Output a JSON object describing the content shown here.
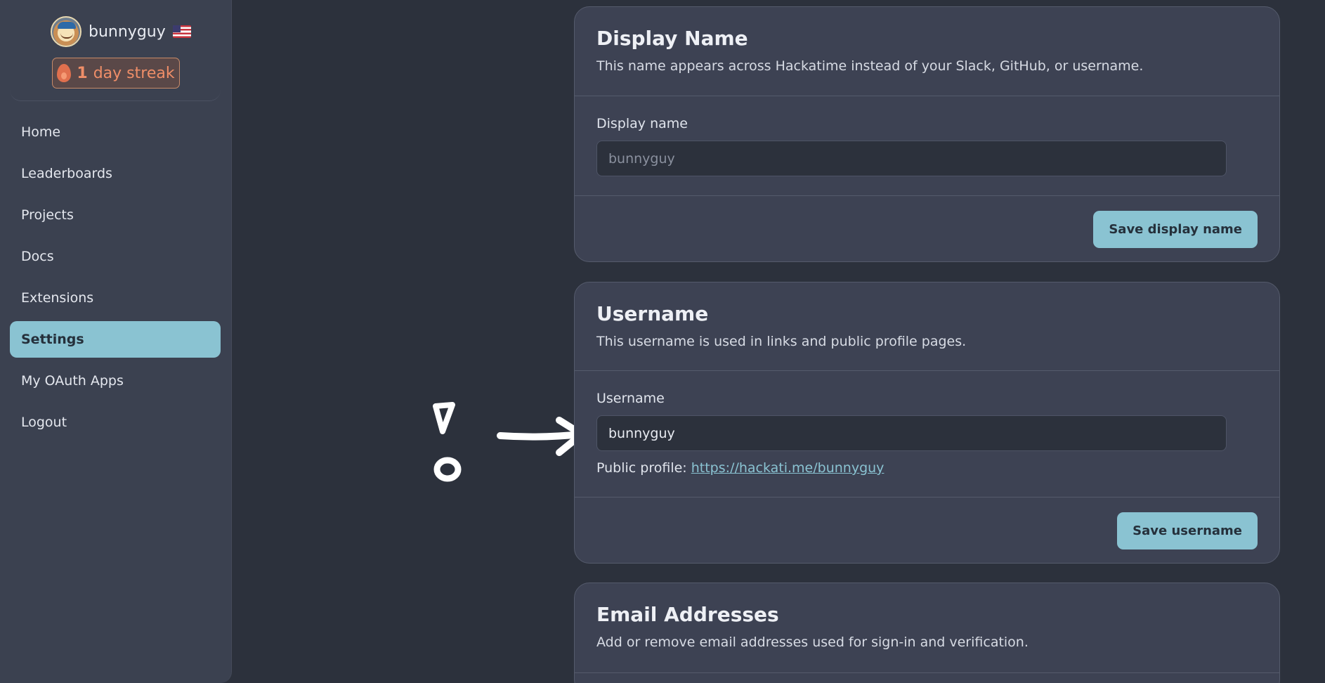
{
  "sidebar": {
    "username": "bunnyguy",
    "streak": {
      "count": "1",
      "label": "day streak"
    },
    "nav": [
      {
        "label": "Home",
        "active": false
      },
      {
        "label": "Leaderboards",
        "active": false
      },
      {
        "label": "Projects",
        "active": false
      },
      {
        "label": "Docs",
        "active": false
      },
      {
        "label": "Extensions",
        "active": false
      },
      {
        "label": "Settings",
        "active": true
      },
      {
        "label": "My OAuth Apps",
        "active": false
      },
      {
        "label": "Logout",
        "active": false
      }
    ]
  },
  "display_name_card": {
    "title": "Display Name",
    "description": "This name appears across Hackatime instead of your Slack, GitHub, or username.",
    "field_label": "Display name",
    "placeholder": "bunnyguy",
    "value": "",
    "save_label": "Save display name"
  },
  "username_card": {
    "title": "Username",
    "description": "This username is used in links and public profile pages.",
    "field_label": "Username",
    "value": "bunnyguy",
    "profile_prefix": "Public profile:",
    "profile_url": "https://hackati.me/bunnyguy",
    "save_label": "Save username"
  },
  "email_card": {
    "title": "Email Addresses",
    "description": "Add or remove email addresses used for sign-in and verification."
  },
  "colors": {
    "accent": "#8ac3d2",
    "background": "#2c313c",
    "card": "#3d4253",
    "streak": "#ef8e68"
  }
}
